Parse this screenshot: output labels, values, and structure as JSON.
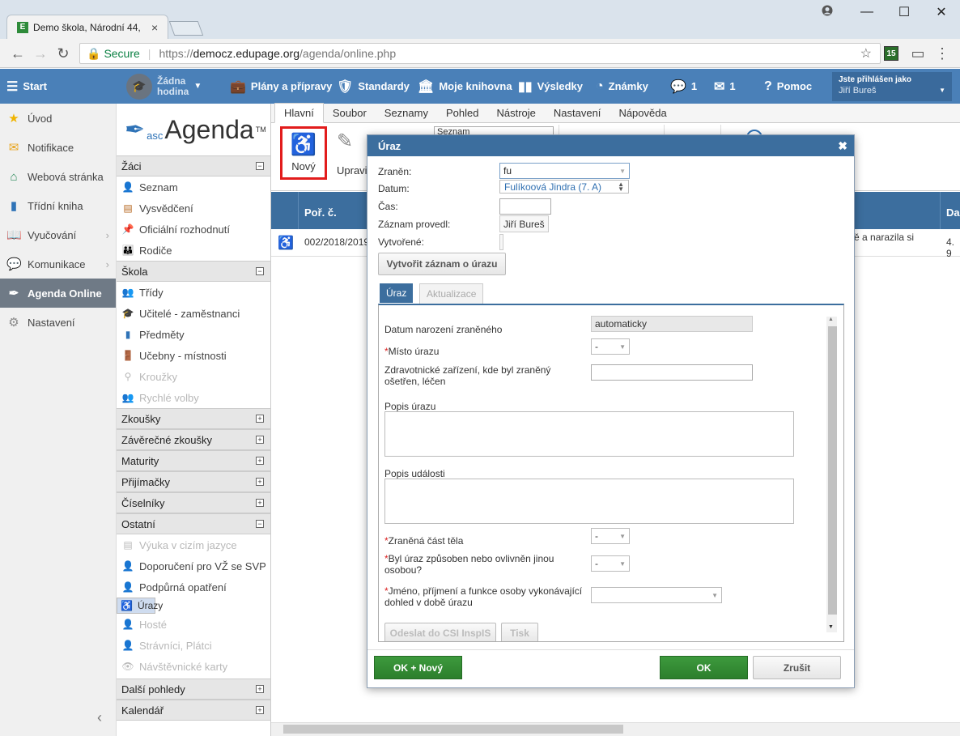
{
  "browser": {
    "tab_title": "Demo škola, Národní 44,",
    "tab_close": "×",
    "secure_label": "Secure",
    "url_prefix": "https://",
    "url_host": "democz.edupage.org",
    "url_path": "/agenda/online.php",
    "ext_badge": "15"
  },
  "topbar": {
    "start": "Start",
    "lesson": "Žádna hodina",
    "lesson_line1": "Žádna",
    "lesson_line2": "hodina",
    "plans": "Plány a přípravy",
    "standards": "Standardy",
    "library": "Moje knihovna",
    "results": "Výsledky",
    "grades": "Známky",
    "messages_count": "1",
    "mail_count": "1",
    "help": "Pomoc",
    "user_label": "Jste přihlášen jako",
    "user_name": "Jiří Bureš"
  },
  "leftnav": [
    {
      "label": "Úvod",
      "icon": "star-icon"
    },
    {
      "label": "Notifikace",
      "icon": "envelope-icon"
    },
    {
      "label": "Webová stránka",
      "icon": "house-icon"
    },
    {
      "label": "Třídní kniha",
      "icon": "book-icon"
    },
    {
      "label": "Vyučování",
      "icon": "open-book-icon"
    },
    {
      "label": "Komunikace",
      "icon": "chat-icon"
    },
    {
      "label": "Agenda Online",
      "icon": "feather-icon"
    },
    {
      "label": "Nastavení",
      "icon": "gear-icon"
    }
  ],
  "logo": {
    "asc": "asc",
    "agenda": "Agenda",
    "tm": "TM"
  },
  "modules": {
    "zaci": {
      "title": "Žáci",
      "items": [
        "Seznam",
        "Vysvědčení",
        "Oficiální rozhodnutí",
        "Rodiče"
      ]
    },
    "skola": {
      "title": "Škola",
      "items": [
        "Třídy",
        "Učitelé - zaměstnanci",
        "Předměty",
        "Učebny - místnosti",
        "Kroužky",
        "Rychlé volby"
      ]
    },
    "collapsed": [
      "Zkoušky",
      "Závěrečné zkoušky",
      "Maturity",
      "Přijímačky",
      "Číselníky"
    ],
    "ostatni": {
      "title": "Ostatní",
      "items": [
        "Výuka v cizím jazyce",
        "Doporučení pro VŽ se SVP",
        "Podpůrná opatření",
        "Úrazy",
        "Hosté",
        "Strávníci, Plátci",
        "Návštěvnické karty"
      ]
    },
    "bottom": [
      "Další pohledy",
      "Kalendář"
    ]
  },
  "ribbon": {
    "tabs": [
      "Hlavní",
      "Soubor",
      "Seznamy",
      "Pohled",
      "Nástroje",
      "Nastavení",
      "Nápověda"
    ],
    "new_label": "Nový",
    "edit_label": "Upravi",
    "list_select": "Seznam"
  },
  "grid": {
    "col_no": "Poř. č.",
    "col_da": "Da",
    "row_no": "002/2018/2019",
    "row_text": "ě a narazila si",
    "row_tail": "4. 9"
  },
  "dialog": {
    "title": "Úraz",
    "close": "✖",
    "injured_label": "Zraněn:",
    "injured_value": "fu",
    "date_label": "Datum:",
    "time_label": "Čas:",
    "recorded_by_label": "Záznam provedl:",
    "recorded_by_value": "Jiří Bureš",
    "created_label": "Vytvořené:",
    "create_record_btn": "Vytvořit záznam o úrazu",
    "autocomplete": "Fulíkoová Jindra (7. A)",
    "tabs": [
      "Úraz",
      "Aktualizace"
    ],
    "fields": {
      "dob_label": "Datum narození zraněného",
      "dob_value": "automaticky",
      "place_label": "Místo úrazu",
      "place_value": "-",
      "facility_label": "Zdravotnické zařízení, kde byl zraněný ošetřen, léčen",
      "desc_label": "Popis úrazu",
      "event_label": "Popis události",
      "bodypart_label": "Zraněná část těla",
      "bodypart_value": "-",
      "other_label": "Byl úraz způsoben nebo ovlivněn jinou osobou?",
      "other_value": "-",
      "supervisor_label": "Jméno, příjmení a funkce osoby vykonávající dohled v době úrazu",
      "req_mark": "*"
    },
    "send_btn": "Odeslat do CSI InspIS",
    "print_btn": "Tisk",
    "ok_new_btn": "OK + Nový",
    "ok_btn": "OK",
    "cancel_btn": "Zrušit"
  }
}
